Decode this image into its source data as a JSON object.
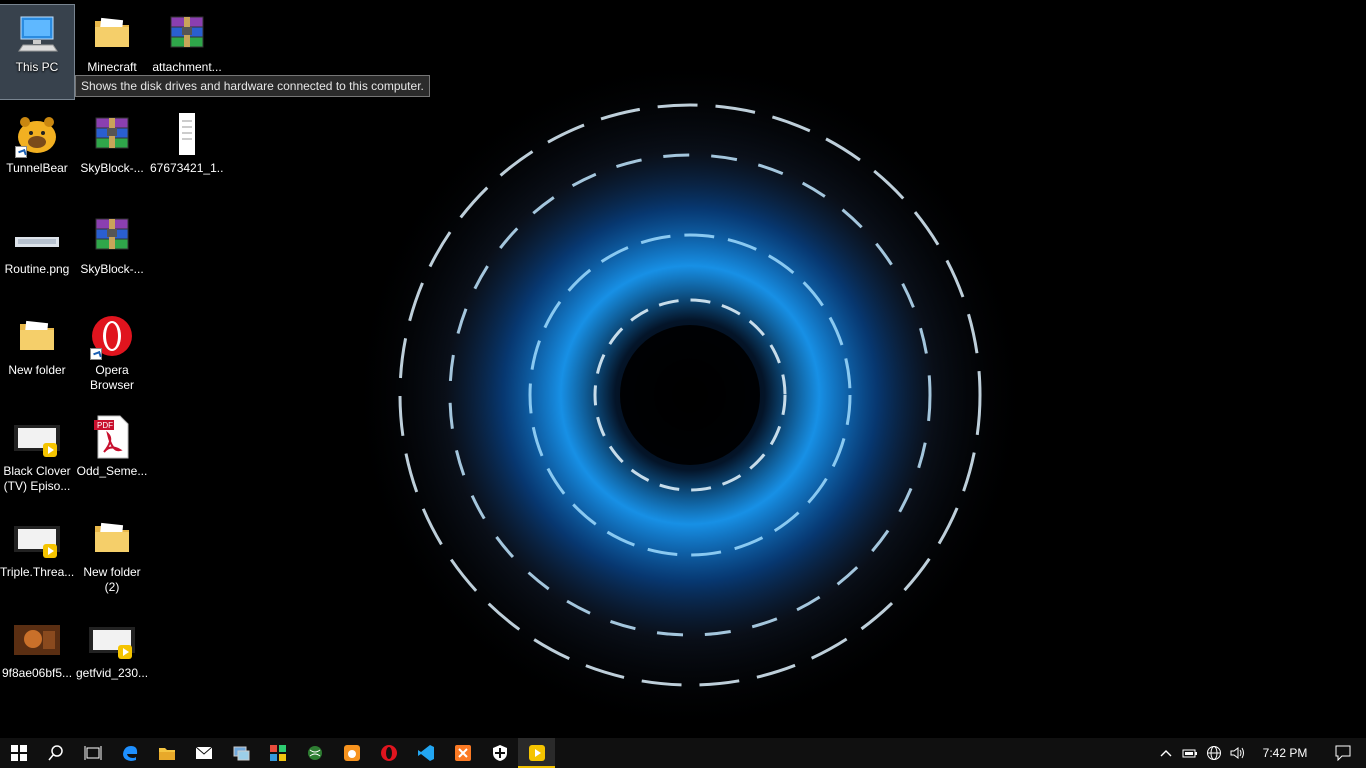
{
  "desktop": {
    "icons": [
      {
        "label": "This PC",
        "icon": "this-pc-icon"
      },
      {
        "label": "Minecraft",
        "icon": "folder-icon"
      },
      {
        "label": "attachment...",
        "icon": "winrar-archive-icon"
      },
      {
        "label": "TunnelBear",
        "icon": "tunnelbear-icon"
      },
      {
        "label": "SkyBlock-...",
        "icon": "winrar-archive-icon"
      },
      {
        "label": "67673421_1...",
        "icon": "document-file-icon"
      },
      {
        "label": "Routine.png",
        "icon": "png-image-icon"
      },
      {
        "label": "SkyBlock-...",
        "icon": "winrar-archive-icon"
      },
      {
        "label": "New folder",
        "icon": "folder-icon"
      },
      {
        "label": "Opera\nBrowser",
        "icon": "opera-icon"
      },
      {
        "label": "Black Clover\n(TV) Episo...",
        "icon": "video-file-icon"
      },
      {
        "label": "Odd_Seme...",
        "icon": "pdf-file-icon"
      },
      {
        "label": "Triple.Threa...",
        "icon": "video-file-icon"
      },
      {
        "label": "New folder\n(2)",
        "icon": "folder-icon"
      },
      {
        "label": "9f8ae06bf5...",
        "icon": "image-file-icon"
      },
      {
        "label": "getfvid_230...",
        "icon": "video-file-icon"
      }
    ],
    "tooltip": "Shows the disk drives and hardware connected to this computer."
  },
  "taskbar": {
    "pinned": [
      "start-icon",
      "search-icon",
      "task-view-icon",
      "edge-icon",
      "file-explorer-icon",
      "mail-icon",
      "network-manager-icon",
      "office-icon",
      "xbox-icon",
      "uc-browser-icon",
      "opera-icon",
      "vscode-icon",
      "xampp-icon",
      "security-icon",
      "media-player-icon"
    ],
    "active_app": "media-player-icon",
    "clock": "7:42 PM"
  },
  "colors": {
    "taskbar_bg": "#101010",
    "accent": "#f0c000",
    "wallpaper_glow": "#2fa8ff"
  }
}
